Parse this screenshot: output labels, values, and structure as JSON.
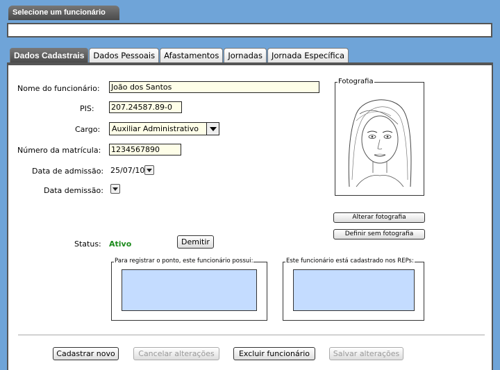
{
  "header": {
    "select_tab": "Selecione um funcionário",
    "select_value": ""
  },
  "tabs": [
    {
      "label": "Dados Cadastrais",
      "active": true
    },
    {
      "label": "Dados Pessoais",
      "active": false
    },
    {
      "label": "Afastamentos",
      "active": false
    },
    {
      "label": "Jornadas",
      "active": false
    },
    {
      "label": "Jornada Específica",
      "active": false
    }
  ],
  "form": {
    "nome_label": "Nome do funcionário:",
    "nome_value": "João dos Santos",
    "pis_label": "PIS:",
    "pis_value": "207.24587.89-0",
    "cargo_label": "Cargo:",
    "cargo_value": "Auxiliar Administrativo",
    "matricula_label": "Número da matrícula:",
    "matricula_value": "1234567890",
    "admissao_label": "Data de admissão:",
    "admissao_value": "25/07/10",
    "demissao_label": "Data demissão:",
    "demissao_value": "",
    "status_label": "Status:",
    "status_value": "Ativo",
    "status_color": "#1a8a1a",
    "demitir_label": "Demitir"
  },
  "photo": {
    "legend": "Fotografia",
    "alterar_label": "Alterar fotografia",
    "sem_foto_label": "Definir sem fotografia"
  },
  "groups": {
    "registro_legend": "Para registrar o ponto, este funcionário possui:",
    "reps_legend": "Este funcionário está cadastrado nos REPs:"
  },
  "actions": {
    "cadastrar_label": "Cadastrar novo",
    "cancelar_label": "Cancelar alterações",
    "excluir_label": "Excluir funcionário",
    "salvar_label": "Salvar alterações"
  },
  "colors": {
    "background": "#6fa4d8",
    "tab_active": "#555555",
    "listbox": "#c4dcff",
    "input_bg": "#fefee8"
  }
}
